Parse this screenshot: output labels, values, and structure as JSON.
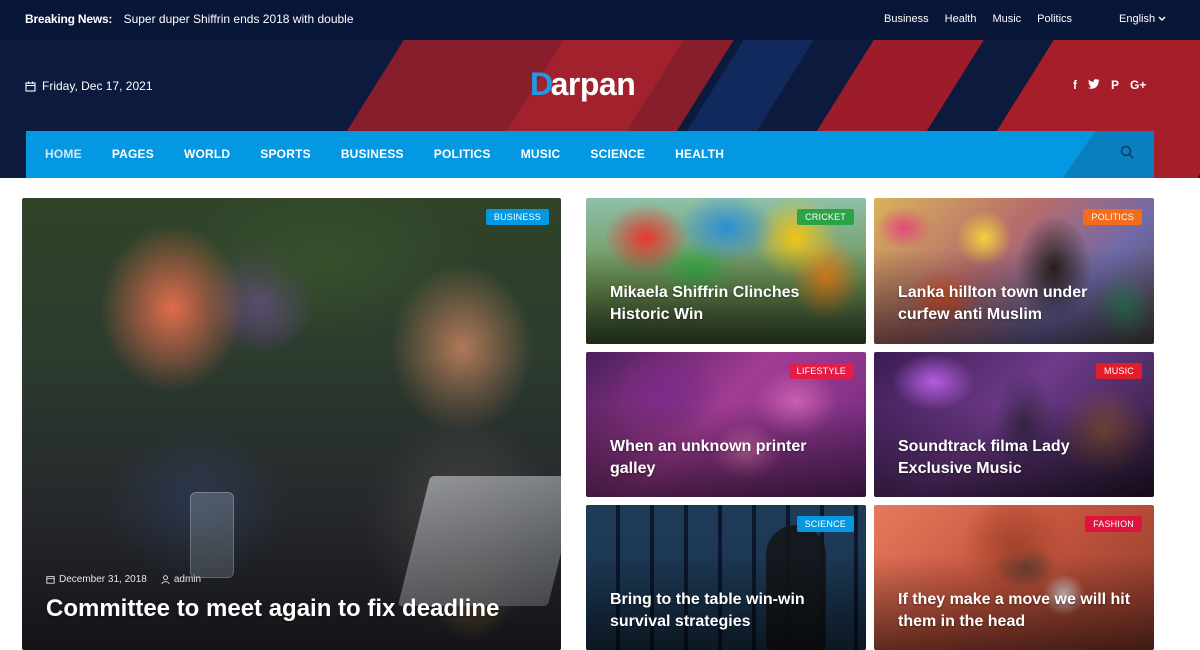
{
  "topbar": {
    "breaking_label": "Breaking News:",
    "breaking_text": "Super duper Shiffrin ends 2018 with double",
    "links": [
      "Business",
      "Health",
      "Music",
      "Politics"
    ],
    "language": "English"
  },
  "header": {
    "date": "Friday, Dec 17, 2021",
    "logo_mark": "D",
    "logo_text": "arpan",
    "social_icons": [
      "facebook-icon",
      "twitter-icon",
      "pinterest-icon",
      "google-plus-icon"
    ],
    "social_glyphs": [
      "f",
      "🐦",
      "P",
      "G+"
    ]
  },
  "nav": {
    "items": [
      "HOME",
      "PAGES",
      "WORLD",
      "SPORTS",
      "BUSINESS",
      "POLITICS",
      "MUSIC",
      "SCIENCE",
      "HEALTH"
    ],
    "active_index": 0
  },
  "colors": {
    "accent": "#0598e2",
    "header_bg": "#0b1a3d",
    "badge_business": "#0598e2",
    "badge_cricket": "#2aa444",
    "badge_politics": "#f26c1b",
    "badge_lifestyle": "#e11d48",
    "badge_music": "#e11d2a",
    "badge_science": "#0598e2",
    "badge_fashion": "#e1123c"
  },
  "hero": {
    "badge": "BUSINESS",
    "date": "December 31, 2018",
    "author": "admin",
    "title": "Committee to meet again to fix deadline"
  },
  "cards": [
    {
      "badge": "CRICKET",
      "title": "Mikaela Shiffrin Clinches Historic Win"
    },
    {
      "badge": "POLITICS",
      "title": "Lanka hillton town under curfew anti Muslim"
    },
    {
      "badge": "LIFESTYLE",
      "title": "When an unknown printer galley"
    },
    {
      "badge": "MUSIC",
      "title": "Soundtrack filma Lady Exclusive Music"
    },
    {
      "badge": "SCIENCE",
      "title": "Bring to the table win-win survival strategies"
    },
    {
      "badge": "FASHION",
      "title": "If they make a move we will hit them in the head"
    }
  ]
}
